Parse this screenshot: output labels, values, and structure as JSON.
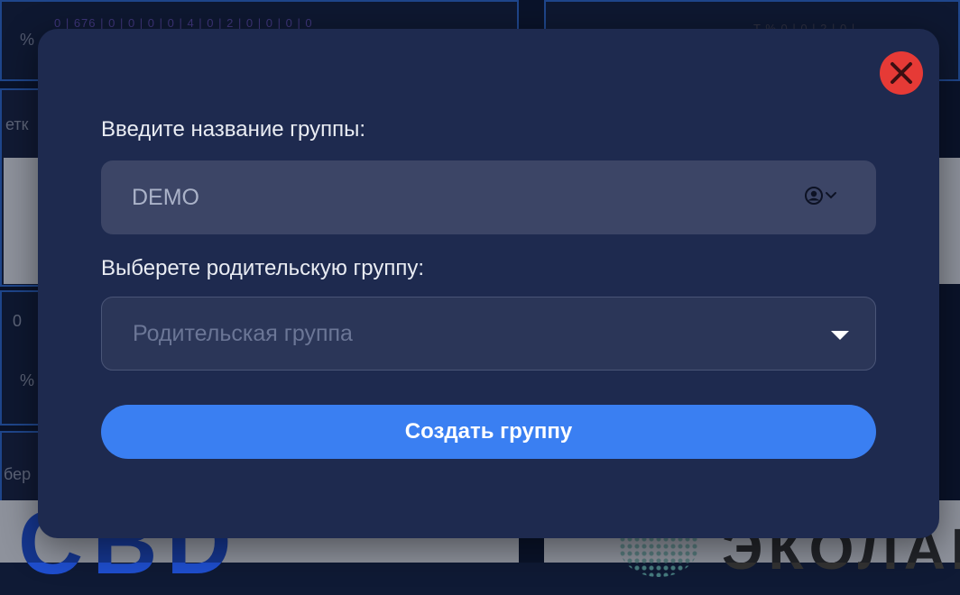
{
  "background": {
    "metrics_left": "0 | 676 | 0 | 0 | 0 | 0 | 4 | 0 | 2 | 0 | 0 | 0 | 0",
    "metrics_right": "T %  0 | 0 | 2 | 0 |",
    "pct_top": "%",
    "label_etk": "етк",
    "value_zero": "0",
    "pct_mid": "%",
    "label_ber": "бер",
    "logo_left": "CBD",
    "logo_right": "ЭКОЛАН"
  },
  "modal": {
    "group_name_label": "Введите название группы:",
    "group_name_value": "DEMO",
    "parent_label": "Выберете родительскую группу:",
    "parent_placeholder": "Родительская группа",
    "create_button": "Создать группу"
  },
  "icons": {
    "close": "close-icon",
    "user": "user-circle-icon",
    "chevron": "chevron-down-icon",
    "caret": "caret-down-icon"
  },
  "colors": {
    "modal_bg": "#1e2a4f",
    "primary": "#3a7ff2",
    "danger": "#e63a36"
  }
}
